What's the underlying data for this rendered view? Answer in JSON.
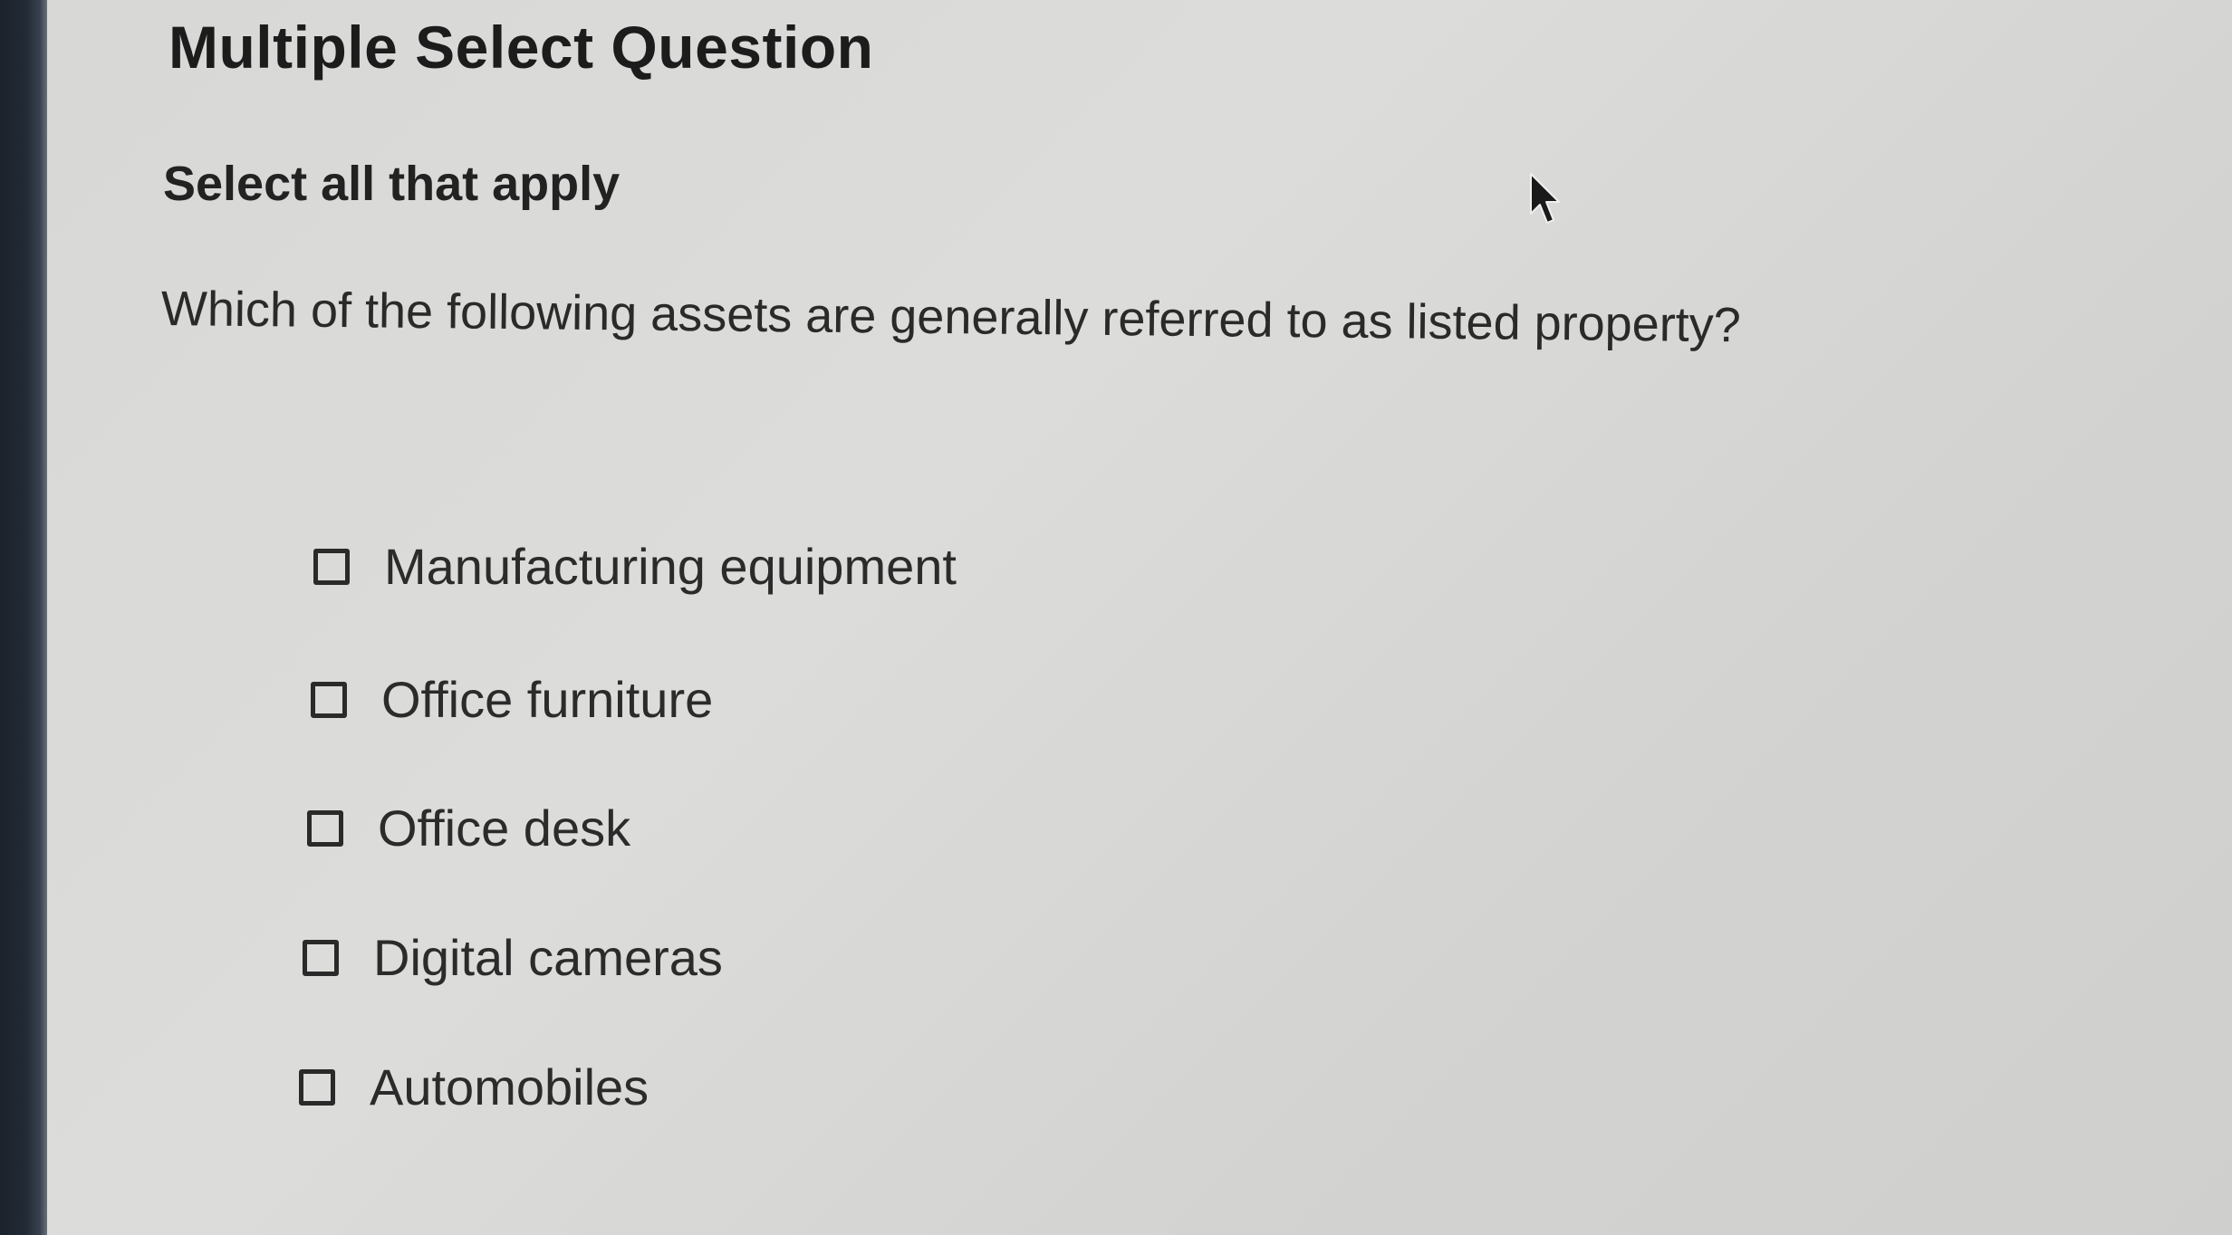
{
  "question": {
    "heading": "Multiple Select Question",
    "instruction": "Select all that apply",
    "prompt": "Which of the following assets are generally referred to as listed property?"
  },
  "options": [
    {
      "label": "Manufacturing equipment",
      "checked": false
    },
    {
      "label": "Office furniture",
      "checked": false
    },
    {
      "label": "Office desk",
      "checked": false
    },
    {
      "label": "Digital cameras",
      "checked": false
    },
    {
      "label": "Automobiles",
      "checked": false
    }
  ],
  "icons": {
    "pointer": "mouse-pointer-icon",
    "checkbox": "checkbox-unchecked"
  },
  "colors": {
    "background": "#d9d9d7",
    "text": "#1f1f1f",
    "bezel": "#1b222c"
  }
}
